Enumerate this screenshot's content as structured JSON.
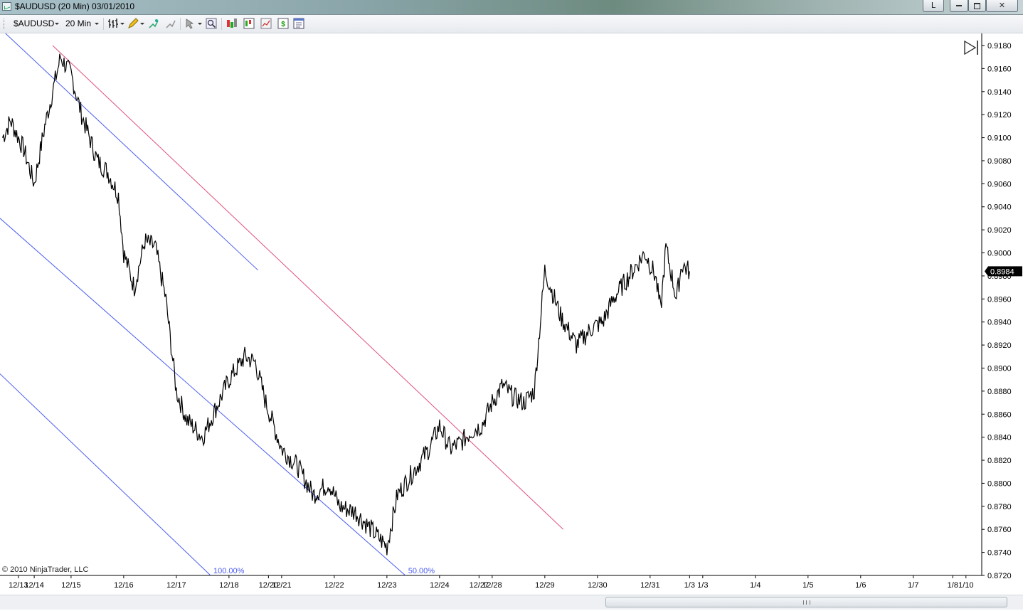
{
  "window": {
    "title": "$AUDUSD (20 Min)  03/01/2010",
    "buttons": {
      "lock": "L",
      "minimize": "minimize-icon",
      "maximize": "maximize-icon",
      "close": "close-icon"
    }
  },
  "toolbar": {
    "instrument": "$AUDUSD",
    "interval": "20 Min",
    "icons": [
      "bar-type-icon",
      "pencil-draw-icon",
      "add-indicator-icon",
      "strategy-icon",
      "pointer-icon",
      "zoom-icon",
      "data-series-icon",
      "indicators-icon",
      "strategies-icon",
      "chart-trader-icon",
      "properties-icon"
    ]
  },
  "copyright": "© 2010 NinjaTrader, LLC",
  "colors": {
    "price": "#000000",
    "channel_blue": "#4a5cf0",
    "channel_red": "#e0507a",
    "price_marker_bg": "#000000"
  },
  "chart_data": {
    "type": "line",
    "title": "",
    "xlabel": "",
    "ylabel": "",
    "ylim": [
      0.872,
      0.918
    ],
    "y_ticks": [
      "0.9180",
      "0.9160",
      "0.9140",
      "0.9120",
      "0.9100",
      "0.9080",
      "0.9060",
      "0.9040",
      "0.9020",
      "0.9000",
      "0.8980",
      "0.8960",
      "0.8940",
      "0.8920",
      "0.8900",
      "0.8880",
      "0.8860",
      "0.8840",
      "0.8820",
      "0.8800",
      "0.8780",
      "0.8760",
      "0.8740",
      "0.8720"
    ],
    "x_ticks": [
      "12/13",
      "12/14",
      "12/15",
      "12/16",
      "12/17",
      "12/18",
      "12/20",
      "12/21",
      "12/22",
      "12/23",
      "12/24",
      "12/27",
      "12/28",
      "12/29",
      "12/30",
      "12/31",
      "1/3",
      "1/3",
      "1/4",
      "1/5",
      "1/6",
      "1/7",
      "1/8",
      "1/10"
    ],
    "x_tick_pos": [
      0,
      0.3,
      1,
      2,
      3,
      4,
      4.75,
      5,
      6,
      7,
      8,
      8.75,
      9,
      10,
      11,
      12,
      12.75,
      13,
      14,
      15,
      16,
      17,
      17.75,
      18
    ],
    "x_range": [
      -0.35,
      18.3
    ],
    "current_price": "0.8984",
    "series": [
      {
        "x": [
          -0.3,
          -0.15,
          0.1,
          0.3,
          0.5,
          0.8,
          1.0,
          1.2,
          1.5,
          1.7,
          1.9,
          2.0,
          2.2,
          2.4,
          2.6,
          2.8,
          3.0,
          3.2,
          3.5,
          3.8,
          4.0,
          4.3,
          4.5,
          4.7,
          5.0,
          5.3,
          5.6,
          5.9,
          6.1,
          6.4,
          6.7,
          7.0,
          7.2,
          7.5,
          7.8,
          8.0,
          8.2,
          8.4,
          8.6,
          8.8,
          9.0,
          9.2,
          9.4,
          9.6,
          9.8,
          10.0,
          10.3,
          10.6,
          10.9,
          11.1,
          11.3,
          11.6,
          11.9,
          12.1,
          12.2,
          12.3,
          12.5,
          12.6,
          12.75
        ],
        "y": [
          0.91,
          0.9115,
          0.909,
          0.906,
          0.911,
          0.917,
          0.9155,
          0.912,
          0.908,
          0.907,
          0.905,
          0.9,
          0.897,
          0.901,
          0.9005,
          0.896,
          0.888,
          0.8855,
          0.884,
          0.887,
          0.889,
          0.891,
          0.8905,
          0.887,
          0.883,
          0.8815,
          0.879,
          0.88,
          0.878,
          0.8775,
          0.876,
          0.8745,
          0.879,
          0.881,
          0.883,
          0.885,
          0.883,
          0.8835,
          0.8845,
          0.885,
          0.887,
          0.8885,
          0.8875,
          0.887,
          0.888,
          0.8985,
          0.8945,
          0.892,
          0.8935,
          0.894,
          0.896,
          0.898,
          0.9,
          0.898,
          0.895,
          0.9005,
          0.896,
          0.899,
          0.8984
        ]
      }
    ],
    "channel_lines": [
      {
        "color": "blue",
        "x": [
          -0.35,
          4.55
        ],
        "y": [
          0.9195,
          0.8985
        ]
      },
      {
        "color": "blue",
        "x": [
          -0.35,
          7.35
        ],
        "y": [
          0.903,
          0.872
        ],
        "label": "50.00%"
      },
      {
        "color": "blue",
        "x": [
          -0.35,
          3.65
        ],
        "y": [
          0.8895,
          0.872
        ],
        "label": "100.00%"
      },
      {
        "color": "red",
        "x": [
          0.65,
          10.35
        ],
        "y": [
          0.918,
          0.876
        ]
      }
    ]
  }
}
